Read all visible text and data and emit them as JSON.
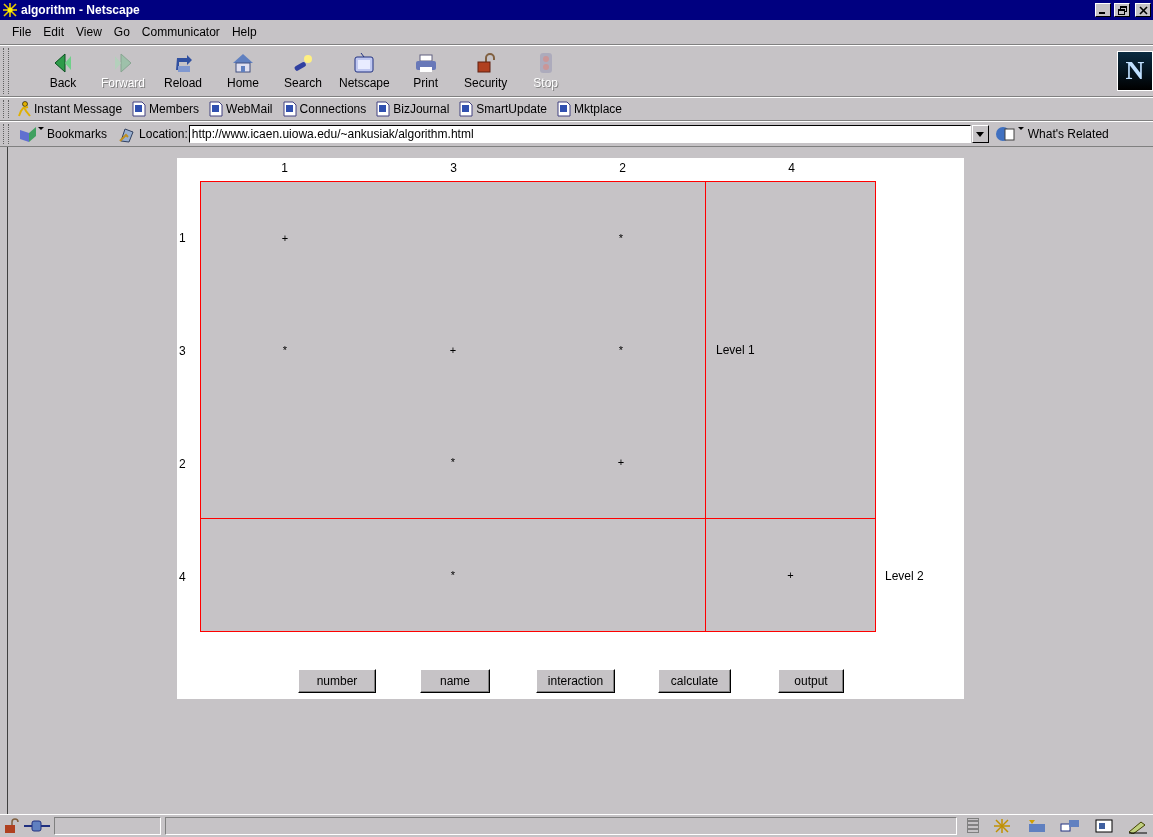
{
  "window": {
    "title": "algorithm - Netscape"
  },
  "menu": [
    "File",
    "Edit",
    "View",
    "Go",
    "Communicator",
    "Help"
  ],
  "navigation_toolbar": [
    {
      "label": "Back",
      "kind": "back",
      "disabled": false
    },
    {
      "label": "Forward",
      "kind": "forward",
      "disabled": true
    },
    {
      "label": "Reload",
      "kind": "reload",
      "disabled": false
    },
    {
      "label": "Home",
      "kind": "home",
      "disabled": false
    },
    {
      "label": "Search",
      "kind": "search",
      "disabled": false
    },
    {
      "label": "Netscape",
      "kind": "portal",
      "disabled": false
    },
    {
      "label": "Print",
      "kind": "print",
      "disabled": false
    },
    {
      "label": "Security",
      "kind": "security",
      "disabled": false
    },
    {
      "label": "Stop",
      "kind": "stop",
      "disabled": true
    }
  ],
  "logo": "N",
  "personal_toolbar": [
    {
      "label": "Instant Message",
      "kind": "messenger"
    },
    {
      "label": "Members",
      "kind": "page"
    },
    {
      "label": "WebMail",
      "kind": "page"
    },
    {
      "label": "Connections",
      "kind": "page"
    },
    {
      "label": "BizJournal",
      "kind": "page"
    },
    {
      "label": "SmartUpdate",
      "kind": "page"
    },
    {
      "label": "Mktplace",
      "kind": "page"
    }
  ],
  "location_bar": {
    "bookmarks": "Bookmarks",
    "label": "Location:",
    "url": "http://www.icaen.uiowa.edu/~ankusiak/algorithm.html",
    "related": "What's Related"
  },
  "applet": {
    "column_headers": [
      "1",
      "3",
      "2",
      "4"
    ],
    "row_headers": [
      "1",
      "3",
      "2",
      "4"
    ],
    "cells": [
      [
        "+",
        null,
        "*"
      ],
      [
        "*",
        "+",
        "*"
      ],
      [
        null,
        "*",
        "+"
      ]
    ],
    "side_block": {
      "label": "Level 1"
    },
    "bottom_block": {
      "mark": "*"
    },
    "corner_block": {
      "mark": "+"
    },
    "bottom_label": "Level 2",
    "buttons": [
      "number",
      "name",
      "interaction",
      "calculate",
      "output"
    ]
  }
}
